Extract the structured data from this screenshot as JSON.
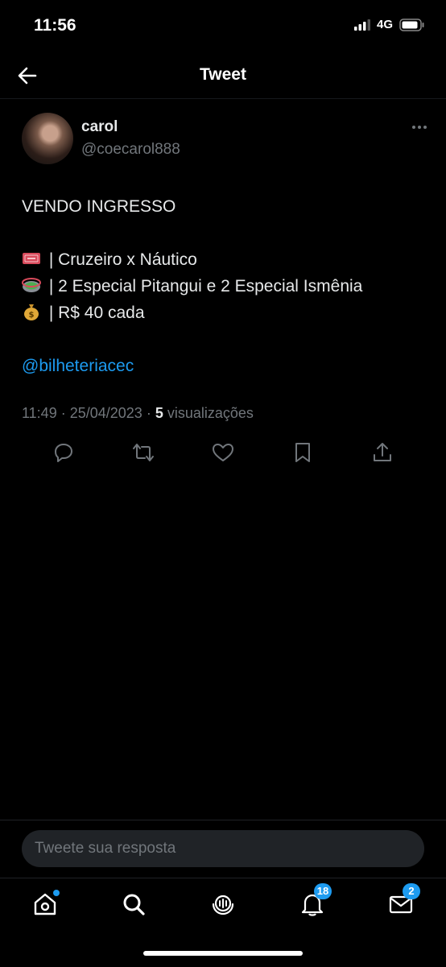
{
  "status_bar": {
    "time": "11:56",
    "network": "4G"
  },
  "header": {
    "title": "Tweet"
  },
  "tweet": {
    "author_name": "carol",
    "author_handle": "@coecarol888",
    "lines": [
      "VENDO INGRESSO",
      "",
      " | Cruzeiro x Náutico",
      " | 2 Especial Pitangui e 2 Especial Ismênia",
      " | R$ 40 cada",
      "",
      "@bilheteriacec"
    ],
    "emojis": [
      "admit-one-ticket-icon",
      "stadium-icon",
      "money-bag-icon"
    ],
    "time": "11:49",
    "separator": " · ",
    "date": "25/04/2023",
    "views_count": "5",
    "views_label": "visualizações"
  },
  "reply": {
    "placeholder": "Tweete sua resposta"
  },
  "tabbar": {
    "notifications_badge": "18",
    "messages_badge": "2"
  },
  "colors": {
    "accent": "#1d9bf0",
    "background": "#000000",
    "muted": "#71767b",
    "text": "#e7e9ea"
  }
}
